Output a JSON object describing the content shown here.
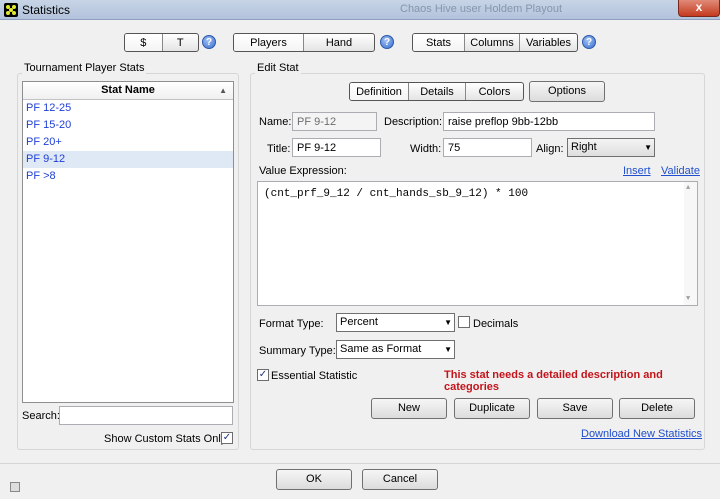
{
  "window": {
    "title": "Statistics",
    "ghost_title": "Chaos Hive user Holdem Playout",
    "close": "x"
  },
  "toolbar": {
    "currency": [
      "$",
      "T"
    ],
    "scope": [
      "Players",
      "Hand"
    ],
    "view": [
      "Stats",
      "Columns",
      "Variables"
    ],
    "help": "?"
  },
  "left": {
    "group": "Tournament Player Stats",
    "column_header": "Stat Name",
    "sort_glyph": "▲",
    "stats": [
      "PF 12-25",
      "PF 15-20",
      "PF 20+",
      "PF 9-12",
      "PF >8"
    ],
    "selected_index": 3,
    "search_label": "Search:",
    "search_value": "",
    "custom_only_label": "Show Custom Stats Only",
    "custom_only_checked": "✓"
  },
  "edit": {
    "group": "Edit Stat",
    "tabs": [
      "Definition",
      "Details",
      "Colors"
    ],
    "options_label": "Options",
    "name_label": "Name:",
    "name_value": "PF 9-12",
    "description_label": "Description:",
    "description_value": "raise preflop 9bb-12bb",
    "title_label": "Title:",
    "title_value": "PF 9-12",
    "width_label": "Width:",
    "width_value": "75",
    "align_label": "Align:",
    "align_value": "Right",
    "value_expr_label": "Value Expression:",
    "insert_label": "Insert",
    "validate_label": "Validate",
    "expression": "(cnt_prf_9_12 / cnt_hands_sb_9_12) * 100",
    "format_type_label": "Format Type:",
    "format_type_value": "Percent",
    "decimals_label": "Decimals",
    "summary_type_label": "Summary Type:",
    "summary_type_value": "Same as Format",
    "essential_label": "Essential Statistic",
    "essential_checked": "✓",
    "warning": "This stat needs a detailed description and categories",
    "buttons": {
      "new": "New",
      "duplicate": "Duplicate",
      "save": "Save",
      "delete": "Delete"
    },
    "download_link": "Download New Statistics"
  },
  "footer": {
    "ok": "OK",
    "cancel": "Cancel"
  },
  "colors": {
    "link": "#1f4fcc",
    "warning": "#c4141b",
    "selection": "#dfe9f6"
  }
}
